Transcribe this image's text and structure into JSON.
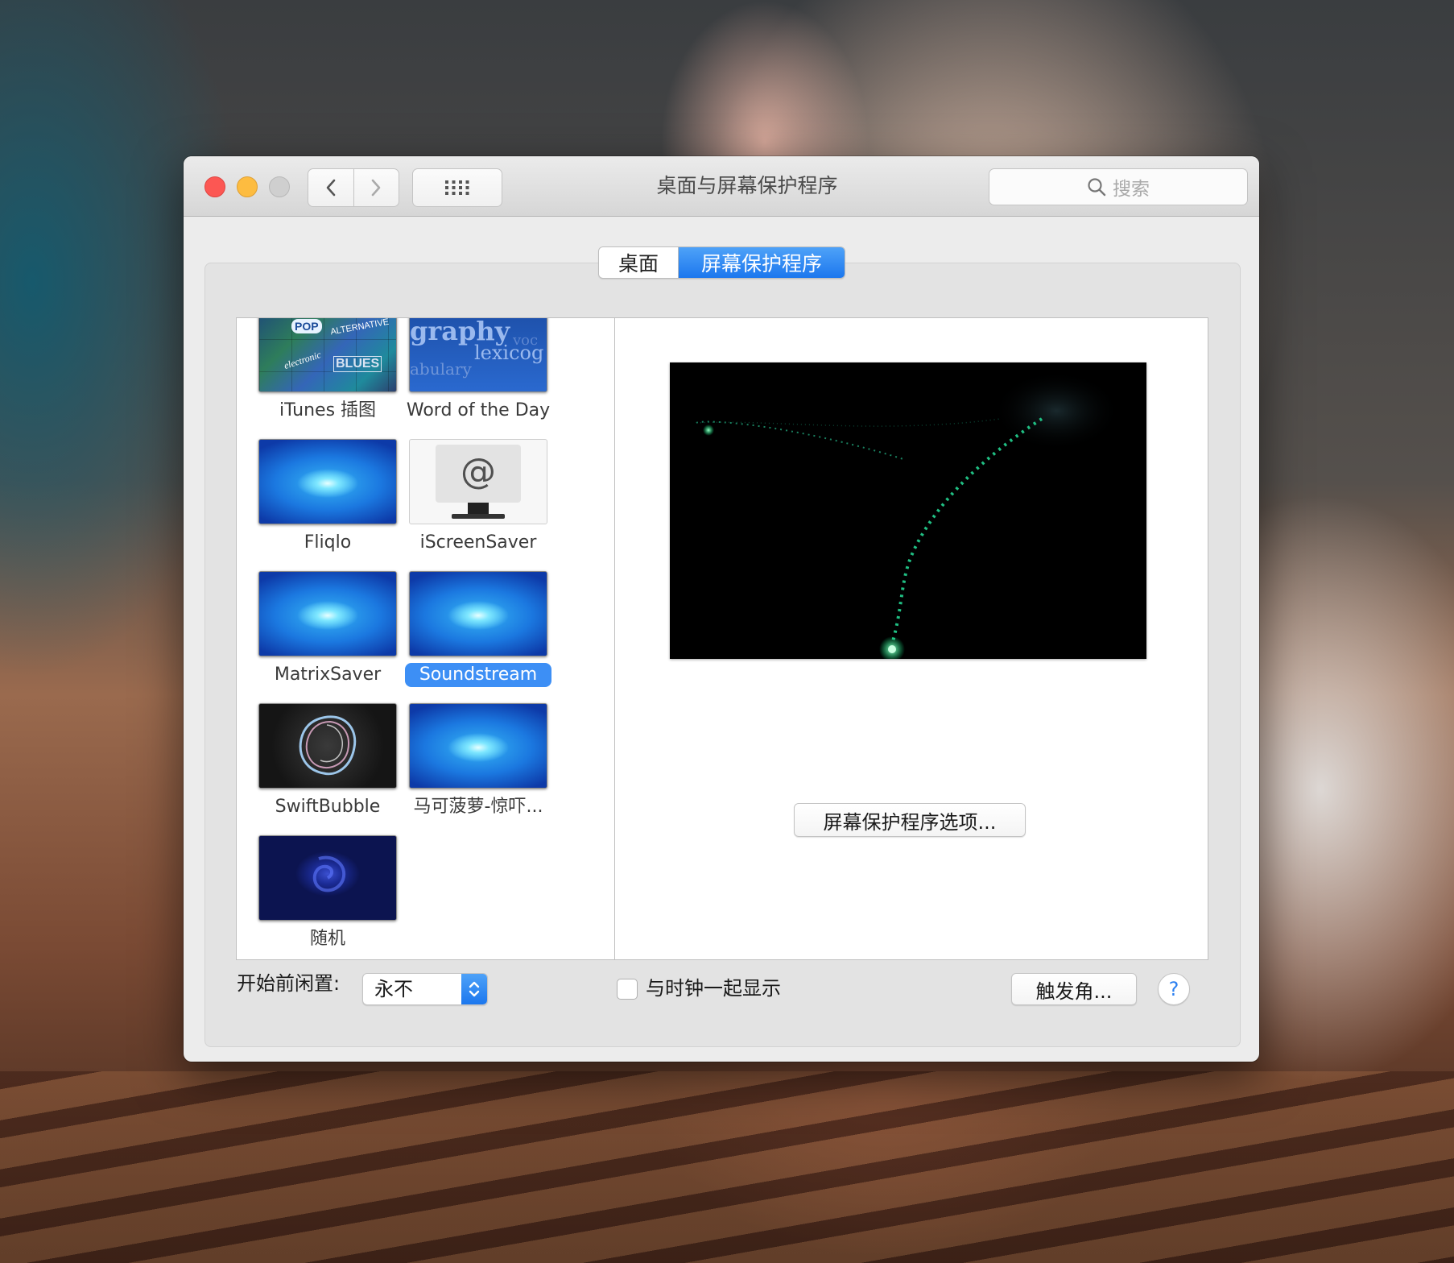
{
  "window": {
    "title": "桌面与屏幕保护程序",
    "search_placeholder": "搜索"
  },
  "tabs": [
    {
      "label": "桌面",
      "selected": false
    },
    {
      "label": "屏幕保护程序",
      "selected": true
    }
  ],
  "screensavers": [
    {
      "label": "iTunes 插图",
      "thumb": "itunes-artwork"
    },
    {
      "label": "Word of the Day",
      "thumb": "word-of-the-day",
      "words": [
        "graphy",
        "voc",
        "lexicog",
        "abulary"
      ]
    },
    {
      "label": "Fliqlo",
      "thumb": "blue-swirl"
    },
    {
      "label": "iScreenSaver",
      "thumb": "at-sign-monitor"
    },
    {
      "label": "MatrixSaver",
      "thumb": "blue-swirl"
    },
    {
      "label": "Soundstream",
      "thumb": "blue-swirl",
      "selected": true
    },
    {
      "label": "SwiftBubble",
      "thumb": "bubble"
    },
    {
      "label": "马可菠萝-惊吓...",
      "thumb": "blue-swirl"
    },
    {
      "label": "随机",
      "thumb": "dark-swirl"
    }
  ],
  "itunes_tile_words": [
    "POP",
    "ALTERNATIVE",
    "electronic",
    "BLUES"
  ],
  "preview": {
    "options_button": "屏幕保护程序选项..."
  },
  "bottom": {
    "idle_label": "开始前闲置:",
    "idle_value": "永不",
    "show_clock_label": "与时钟一起显示",
    "show_clock_checked": false,
    "hot_corners_button": "触发角...",
    "help_symbol": "?"
  },
  "colors": {
    "accent": "#1c77ee",
    "close": "#fc5753",
    "minimize": "#fdbc40"
  }
}
